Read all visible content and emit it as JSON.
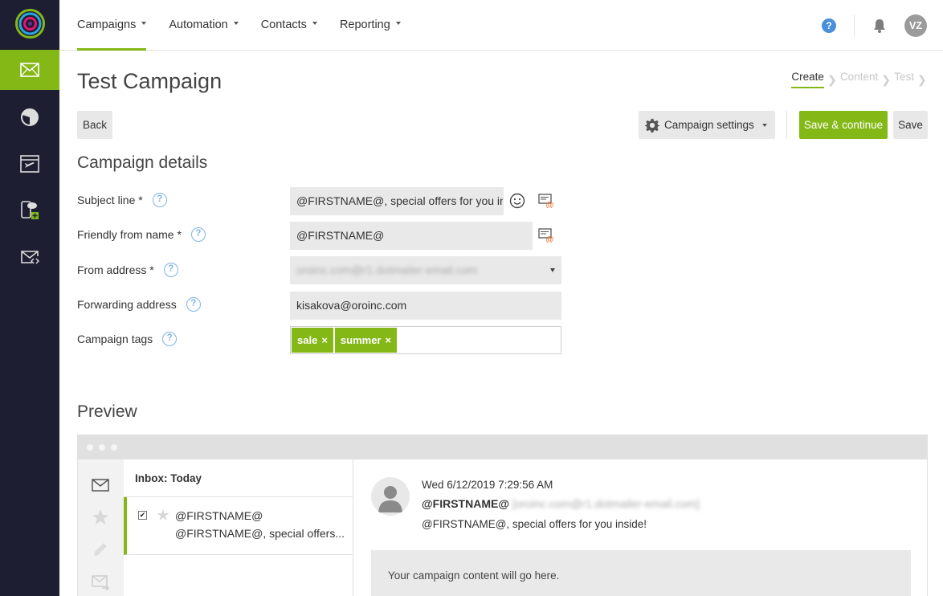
{
  "colors": {
    "accent": "#84b817",
    "rail_bg": "#1e1e33",
    "help_blue": "#4a8fdb"
  },
  "rail": {
    "items": [
      {
        "name": "email-icon",
        "active": true
      },
      {
        "name": "reports-pie-icon",
        "active": false
      },
      {
        "name": "journeys-icon",
        "active": false
      },
      {
        "name": "sms-icon",
        "active": false
      },
      {
        "name": "transactional-email-icon",
        "active": false
      }
    ]
  },
  "topnav": {
    "menu": [
      {
        "label": "Campaigns",
        "active": true
      },
      {
        "label": "Automation",
        "active": false
      },
      {
        "label": "Contacts",
        "active": false
      },
      {
        "label": "Reporting",
        "active": false
      }
    ],
    "help_glyph": "?",
    "avatar_initials": "VZ"
  },
  "page": {
    "title": "Test Campaign",
    "steps": [
      "Create",
      "Content",
      "Test"
    ],
    "active_step": "Create"
  },
  "toolbar": {
    "back_label": "Back",
    "settings_label": "Campaign settings",
    "save_continue_label": "Save & continue",
    "save_label": "Save"
  },
  "details": {
    "title": "Campaign details",
    "subject_label": "Subject line *",
    "subject_value": "@FIRSTNAME@, special offers for you ins",
    "friendly_label": "Friendly from name *",
    "friendly_value": "@FIRSTNAME@",
    "from_label": "From address *",
    "from_value": "oroinc.com@r1.dotmailer-email.com",
    "forwarding_label": "Forwarding address",
    "forwarding_value": "kisakova@oroinc.com",
    "tags_label": "Campaign tags",
    "tags": [
      "sale",
      "summer"
    ],
    "tag_remove_glyph": "×",
    "help_glyph": "?"
  },
  "preview": {
    "title": "Preview",
    "inbox_header": "Inbox: Today",
    "msg_from": "@FIRSTNAME@",
    "msg_subject": "@FIRSTNAME@, special offers...",
    "date": "Wed 6/12/2019 7:29:56 AM",
    "from_name": "@FIRSTNAME@",
    "from_address": "[oroinc.com@r1.dotmailer-email.com]",
    "subject": "@FIRSTNAME@, special offers for you inside!",
    "content_placeholder": "Your campaign content will go here."
  }
}
